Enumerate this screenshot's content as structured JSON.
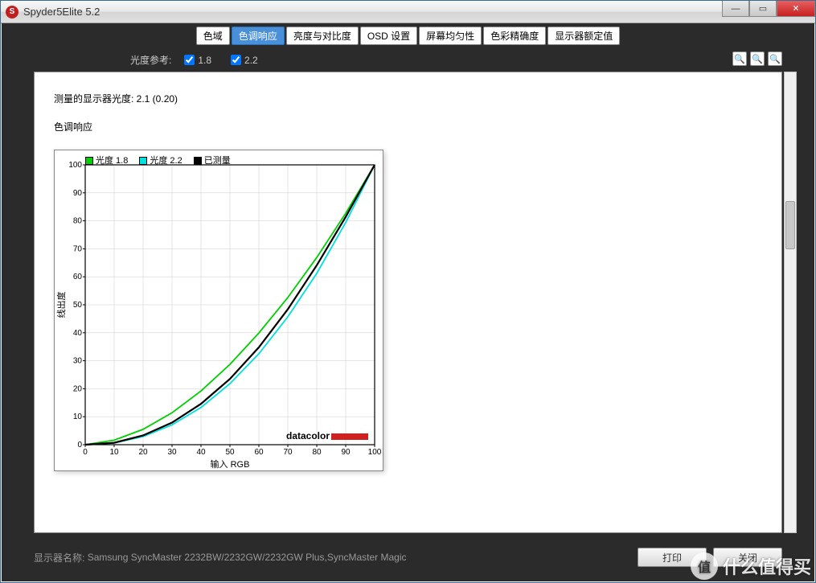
{
  "window": {
    "title": "Spyder5Elite 5.2",
    "icon_letter": "S"
  },
  "tabs": [
    {
      "label": "色域",
      "active": false
    },
    {
      "label": "色调响应",
      "active": true
    },
    {
      "label": "亮度与对比度",
      "active": false
    },
    {
      "label": "OSD 设置",
      "active": false
    },
    {
      "label": "屏幕均匀性",
      "active": false
    },
    {
      "label": "色彩精确度",
      "active": false
    },
    {
      "label": "显示器额定值",
      "active": false
    }
  ],
  "controls": {
    "label": "光度参考:",
    "opt1": {
      "checked": true,
      "label": "1.8"
    },
    "opt2": {
      "checked": true,
      "label": "2.2"
    }
  },
  "zoom": {
    "in": "+",
    "out": "−",
    "fit": "⤢"
  },
  "info": {
    "measured_line": "测量的显示器光度:   2.1 (0.20)",
    "subtitle": "色调响应"
  },
  "legend": {
    "g18": "光度 1.8",
    "g22": "光度 2.2",
    "meas": "已测量"
  },
  "brand": "datacolor",
  "footer": {
    "monitor_label": "显示器名称:",
    "monitor_value": "Samsung SyncMaster 2232BW/2232GW/2232GW Plus,SyncMaster Magic",
    "btn_print": "打印",
    "btn_close": "关闭"
  },
  "watermark": "什么值得买",
  "chart_data": {
    "type": "line",
    "title": "色调响应",
    "xlabel": "输入 RGB",
    "ylabel": "线出度",
    "xlim": [
      0,
      100
    ],
    "ylim": [
      0,
      100
    ],
    "xticks": [
      0,
      10,
      20,
      30,
      40,
      50,
      60,
      70,
      80,
      90,
      100
    ],
    "yticks": [
      0,
      10,
      20,
      30,
      40,
      50,
      60,
      70,
      80,
      90,
      100
    ],
    "x": [
      0,
      10,
      20,
      30,
      40,
      50,
      60,
      70,
      80,
      90,
      100
    ],
    "series": [
      {
        "name": "光度 1.8",
        "color": "#00d000",
        "values": [
          0,
          1.6,
          5.5,
          11.4,
          19.2,
          28.7,
          39.9,
          52.6,
          66.9,
          82.7,
          100
        ]
      },
      {
        "name": "光度 2.2",
        "color": "#00e0e0",
        "values": [
          0,
          0.6,
          2.9,
          7.1,
          13.3,
          21.8,
          32.5,
          45.7,
          61.2,
          79.4,
          100
        ]
      },
      {
        "name": "已测量",
        "color": "#000000",
        "values": [
          0,
          0.7,
          3.3,
          7.9,
          14.6,
          23.5,
          34.8,
          48.4,
          64.1,
          81.4,
          100
        ]
      }
    ],
    "brand": "datacolor"
  }
}
